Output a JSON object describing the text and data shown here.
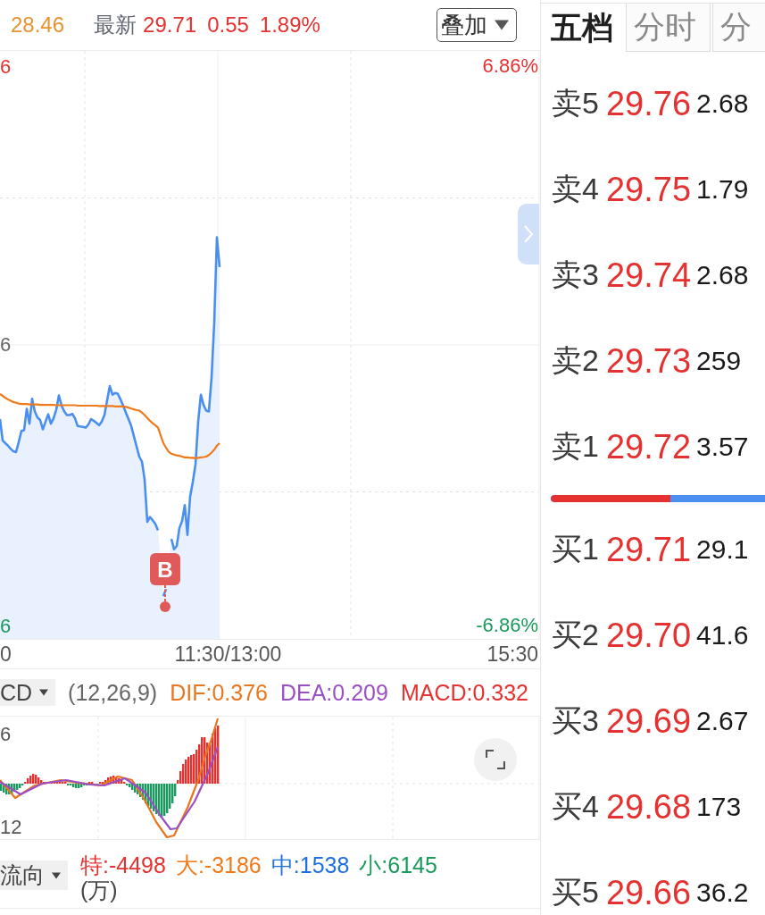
{
  "header": {
    "avg_price": "28.46",
    "latest_label": "最新",
    "latest_price": "29.71",
    "change": "0.55",
    "change_percent": "1.89%",
    "overlay_button": "叠加"
  },
  "price_chart": {
    "left_axis_labels": [
      {
        "text": "6",
        "color": "#e5312f"
      },
      {
        "text": "6",
        "color": "#666666"
      },
      {
        "text": "6",
        "color": "#1a9a5a"
      }
    ],
    "chart_data": {
      "type": "line",
      "categories": [
        null,
        null,
        null,
        null,
        null,
        null,
        null,
        null,
        null,
        null,
        null,
        null,
        null,
        null,
        null,
        null,
        null,
        null,
        null,
        null,
        null,
        null,
        null,
        null,
        null,
        null,
        null,
        null,
        null,
        null,
        null,
        null,
        null,
        null,
        null,
        null,
        null,
        null,
        null,
        null,
        null,
        null,
        null,
        null,
        null,
        null,
        null,
        null,
        null,
        null,
        null,
        null,
        null,
        null,
        null,
        null,
        null,
        null,
        null,
        null,
        null,
        null,
        null,
        null,
        null,
        null,
        null,
        null,
        null,
        null,
        null,
        null,
        null,
        null,
        null,
        null,
        null,
        null,
        null,
        null,
        null,
        null,
        null,
        null,
        null,
        null,
        null,
        null,
        null,
        null,
        null,
        null,
        null,
        null,
        null,
        null,
        null,
        null,
        null,
        null,
        null,
        null,
        null,
        null,
        null,
        null,
        null,
        null,
        null,
        null,
        null,
        null,
        null,
        null,
        null,
        null,
        null,
        null,
        null,
        null,
        null,
        null,
        null,
        null,
        null,
        null,
        null,
        null,
        null,
        null,
        null,
        null,
        null,
        null,
        null,
        null,
        null,
        null,
        null,
        null,
        null,
        null,
        null,
        null,
        null,
        null,
        null,
        null,
        null,
        null,
        null,
        null,
        null,
        null,
        null,
        null,
        null,
        null,
        null,
        null,
        null,
        null,
        null,
        null,
        null,
        null,
        null,
        null,
        null,
        null,
        null,
        null,
        null,
        null,
        null,
        null,
        null,
        null,
        null,
        null,
        null,
        null,
        null,
        null,
        null,
        null,
        null,
        null,
        null,
        null,
        null,
        null,
        null,
        null,
        null,
        null,
        null,
        null,
        null,
        null,
        null,
        null
      ],
      "series": [
        {
          "color": "#4a8ff0",
          "values": [
            -1.79,
            -2.31,
            -2.38,
            -2.44,
            -2.52,
            -2.58,
            -2.6,
            -2.35,
            -2.08,
            -2.06,
            -1.54,
            -1.9,
            -1.29,
            -1.6,
            -1.75,
            -1.81,
            -2.04,
            -1.85,
            -1.67,
            -1.9,
            -1.77,
            -1.56,
            -1.21,
            -1.46,
            -1.6,
            -1.69,
            -1.69,
            -1.66,
            -1.77,
            -1.96,
            -1.97,
            -1.98,
            -2.0,
            -1.92,
            -1.79,
            -1.83,
            -1.88,
            -1.94,
            -1.85,
            -1.69,
            -1.33,
            -0.98,
            -1.19,
            -1.15,
            -1.17,
            -1.31,
            -1.46,
            -1.63,
            -1.79,
            -1.96,
            -2.21,
            -2.46,
            -2.71,
            -2.83,
            -3.27,
            -4.31,
            -4.19,
            -4.27,
            -4.36,
            -4.52,
            null,
            -6.13,
            -5.96,
            null,
            -4.73,
            -4.98,
            -4.9,
            -4.46,
            -4.29,
            -3.9,
            -4.63,
            -3.69,
            -3.33,
            -2.9,
            -1.85,
            -1.19,
            -1.44,
            -1.58,
            -1.6,
            -0.77,
            0.58,
            2.67,
            1.94,
            null,
            null,
            null,
            null,
            null,
            null,
            null,
            null,
            null,
            null,
            null,
            null,
            null,
            null,
            null,
            null,
            null,
            null,
            null,
            null,
            null,
            null,
            null,
            null,
            null,
            null,
            null,
            null,
            null,
            null,
            null,
            null,
            null,
            null,
            null,
            null,
            null,
            null,
            null,
            null,
            null,
            null,
            null,
            null,
            null,
            null,
            null,
            null,
            null,
            null,
            null,
            null,
            null,
            null,
            null,
            null,
            null,
            null,
            null,
            null,
            null,
            null,
            null,
            null,
            null,
            null,
            null,
            null,
            null,
            null,
            null,
            null,
            null,
            null,
            null,
            null,
            null,
            null,
            null,
            null,
            null,
            null,
            null,
            null,
            null,
            null,
            null,
            null,
            null,
            null,
            null,
            null,
            null,
            null,
            null,
            null,
            null,
            null,
            null,
            null,
            null,
            null,
            null,
            null,
            null,
            null,
            null,
            null,
            null,
            null,
            null,
            null,
            null,
            null,
            null,
            null,
            null,
            null,
            null
          ]
        },
        {
          "color": "#f07a1a",
          "values": [
            -1.17,
            -1.22,
            -1.27,
            -1.31,
            -1.34,
            -1.37,
            -1.39,
            -1.41,
            -1.42,
            -1.42,
            -1.42,
            -1.43,
            -1.43,
            -1.43,
            -1.43,
            -1.44,
            -1.44,
            -1.44,
            -1.44,
            -1.44,
            -1.44,
            -1.45,
            -1.45,
            -1.45,
            -1.45,
            -1.45,
            -1.45,
            -1.45,
            -1.45,
            -1.46,
            -1.46,
            -1.46,
            -1.46,
            -1.46,
            -1.46,
            -1.46,
            -1.46,
            -1.47,
            -1.47,
            -1.47,
            -1.47,
            -1.47,
            -1.47,
            -1.48,
            -1.48,
            -1.48,
            -1.48,
            -1.49,
            -1.51,
            -1.53,
            -1.55,
            -1.57,
            -1.58,
            -1.63,
            -1.69,
            -1.76,
            -1.83,
            -1.89,
            -1.94,
            -2.0,
            -2.19,
            -2.38,
            -2.49,
            -2.59,
            -2.64,
            -2.66,
            -2.68,
            -2.69,
            -2.71,
            -2.73,
            -2.73,
            -2.74,
            -2.74,
            -2.75,
            -2.74,
            -2.73,
            -2.72,
            -2.71,
            -2.67,
            -2.61,
            -2.54,
            -2.44,
            -2.38,
            null,
            null,
            null,
            null,
            null,
            null,
            null,
            null,
            null,
            null,
            null,
            null,
            null,
            null,
            null,
            null,
            null,
            null,
            null,
            null,
            null,
            null,
            null,
            null,
            null,
            null,
            null,
            null,
            null,
            null,
            null,
            null,
            null,
            null,
            null,
            null,
            null,
            null,
            null,
            null,
            null,
            null,
            null,
            null,
            null,
            null,
            null,
            null,
            null,
            null,
            null,
            null,
            null,
            null,
            null,
            null,
            null,
            null,
            null,
            null,
            null,
            null,
            null,
            null,
            null,
            null,
            null,
            null,
            null,
            null,
            null,
            null,
            null,
            null,
            null,
            null,
            null,
            null,
            null,
            null,
            null,
            null,
            null,
            null,
            null,
            null,
            null,
            null,
            null,
            null,
            null,
            null,
            null,
            null,
            null,
            null,
            null,
            null,
            null,
            null,
            null,
            null,
            null,
            null,
            null,
            null,
            null,
            null,
            null,
            null,
            null,
            null,
            null,
            null,
            null,
            null,
            null,
            null,
            null
          ]
        }
      ],
      "ylim": [
        -7.18,
        7.24
      ],
      "yticks": [
        {
          "value": 6.86,
          "label": "6.86%"
        },
        {
          "value": -6.86,
          "label": "-6.86%"
        }
      ],
      "annotations": [
        {
          "text": "B"
        }
      ]
    },
    "time_labels": [
      "0",
      "11:30/13:00",
      "15:30"
    ]
  },
  "macd": {
    "dropdown": "CD",
    "params": "(12,26,9)",
    "values": [
      {
        "text": "DIF:0.376",
        "color": "#e8761f"
      },
      {
        "text": "DEA:0.209",
        "color": "#9b4fc4"
      },
      {
        "text": "MACD:0.332",
        "color": "#e5312f"
      }
    ],
    "axis_labels": [
      "6",
      "12"
    ]
  },
  "fund_flow": {
    "dropdown": "流向",
    "values": [
      {
        "text": "特:-4498",
        "color": "#e5312f"
      },
      {
        "text": "大:-3186",
        "color": "#f07a1a"
      },
      {
        "text": "中:1538",
        "color": "#1e6fe0"
      },
      {
        "text": "小:6145",
        "color": "#1a9a5a"
      }
    ],
    "unit": "(万)"
  },
  "order_book": {
    "tabs": [
      {
        "label": "五档",
        "selected": true
      },
      {
        "label": "分时",
        "selected": false
      },
      {
        "label": "分",
        "selected": false
      }
    ],
    "asks": [
      {
        "label": "卖5",
        "price": "29.76",
        "volume": "2.68"
      },
      {
        "label": "卖4",
        "price": "29.75",
        "volume": "1.79"
      },
      {
        "label": "卖3",
        "price": "29.74",
        "volume": "2.68"
      },
      {
        "label": "卖2",
        "price": "29.73",
        "volume": "259"
      },
      {
        "label": "卖1",
        "price": "29.72",
        "volume": "3.57"
      }
    ],
    "ratio_bar": {
      "level": 0.56
    },
    "bids": [
      {
        "label": "买1",
        "price": "29.71",
        "volume": "29.1"
      },
      {
        "label": "买2",
        "price": "29.70",
        "volume": "41.6"
      },
      {
        "label": "买3",
        "price": "29.69",
        "volume": "2.67"
      },
      {
        "label": "买4",
        "price": "29.68",
        "volume": "173"
      },
      {
        "label": "买5",
        "price": "29.66",
        "volume": "36.2"
      }
    ]
  }
}
